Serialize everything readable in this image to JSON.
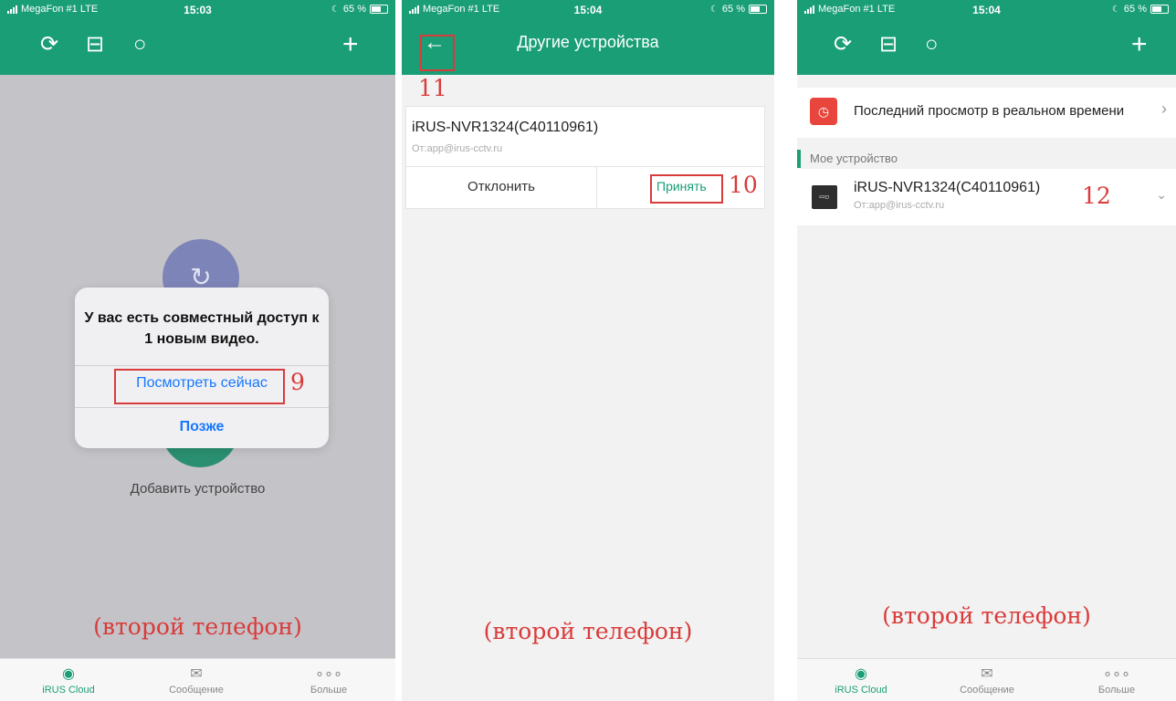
{
  "status_bars": [
    {
      "carrier": "MegaFon #1  LTE",
      "time": "15:03",
      "battery": "65 %"
    },
    {
      "carrier": "MegaFon #1  LTE",
      "time": "15:04",
      "battery": "65 %"
    },
    {
      "carrier": "MegaFon #1  LTE",
      "time": "15:04",
      "battery": "65 %"
    }
  ],
  "toolbar_icons": [
    "history-icon",
    "layout-icon",
    "search-icon",
    "plus-icon"
  ],
  "phone1": {
    "add_device_label": "Добавить устройство",
    "dialog": {
      "message": "У вас есть совместный доступ к 1 новым видео.",
      "view_now": "Посмотреть сейчас",
      "later": "Позже"
    },
    "step_number": "9",
    "caption": "(второй телефон)"
  },
  "phone2": {
    "title": "Другие устройства",
    "step_number_back": "11",
    "device_name": "iRUS-NVR1324(C40110961)",
    "from": "От:app@irus-cctv.ru",
    "decline": "Отклонить",
    "accept": "Принять",
    "step_number_accept": "10",
    "caption": "(второй телефон)"
  },
  "phone3": {
    "last_live": "Последний просмотр в реальном времени",
    "section": "Мое устройство",
    "device_name": "iRUS-NVR1324(C40110961)",
    "from": "От:app@irus-cctv.ru",
    "step_number": "12",
    "caption": "(второй телефон)"
  },
  "tabs": [
    {
      "label": "iRUS Cloud",
      "icon": "cloud-icon",
      "active": true
    },
    {
      "label": "Сообщение",
      "icon": "envelope-icon",
      "active": false
    },
    {
      "label": "Больше",
      "icon": "more-icon",
      "active": false
    }
  ],
  "colors": {
    "brand_green": "#1a9e76",
    "annotation_red": "#d93b3b",
    "link_blue": "#1677ff"
  }
}
